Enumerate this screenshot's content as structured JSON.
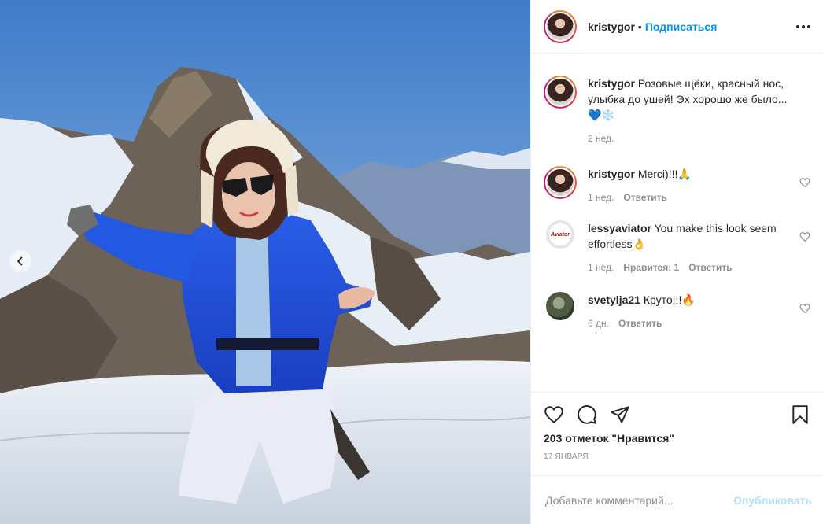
{
  "post": {
    "username": "kristygor",
    "separator": "•",
    "follow_label": "Подписаться",
    "more_icon": "more-horizontal-icon",
    "photo_description_icon": "chevron-left-icon"
  },
  "caption": {
    "username": "kristygor",
    "text": "Розовые щёки, красный нос, улыбка до ушей! Эх хорошо же было...💙❄️",
    "time": "2 нед."
  },
  "comments": [
    {
      "username": "kristygor",
      "text": "Merci)!!!🙏",
      "time": "1 нед.",
      "likes": "",
      "reply": "Ответить"
    },
    {
      "username": "lessyaviator",
      "text": "You make this look seem effortless👌",
      "time": "1 нед.",
      "likes": "Нравится: 1",
      "reply": "Ответить",
      "avatar_text": "Aviator"
    },
    {
      "username": "svetylja21",
      "text": "Круто!!!🔥",
      "time": "6 дн.",
      "likes": "",
      "reply": "Ответить"
    }
  ],
  "actions": {
    "likes_count": "203 отметок \"Нравится\"",
    "date": "17 января"
  },
  "add_comment": {
    "placeholder": "Добавьте комментарий...",
    "publish_label": "Опубликовать"
  },
  "colors": {
    "accent": "#0095f6",
    "publish_disabled": "#b2dffc",
    "muted": "#8e8e8e",
    "text": "#262626"
  }
}
